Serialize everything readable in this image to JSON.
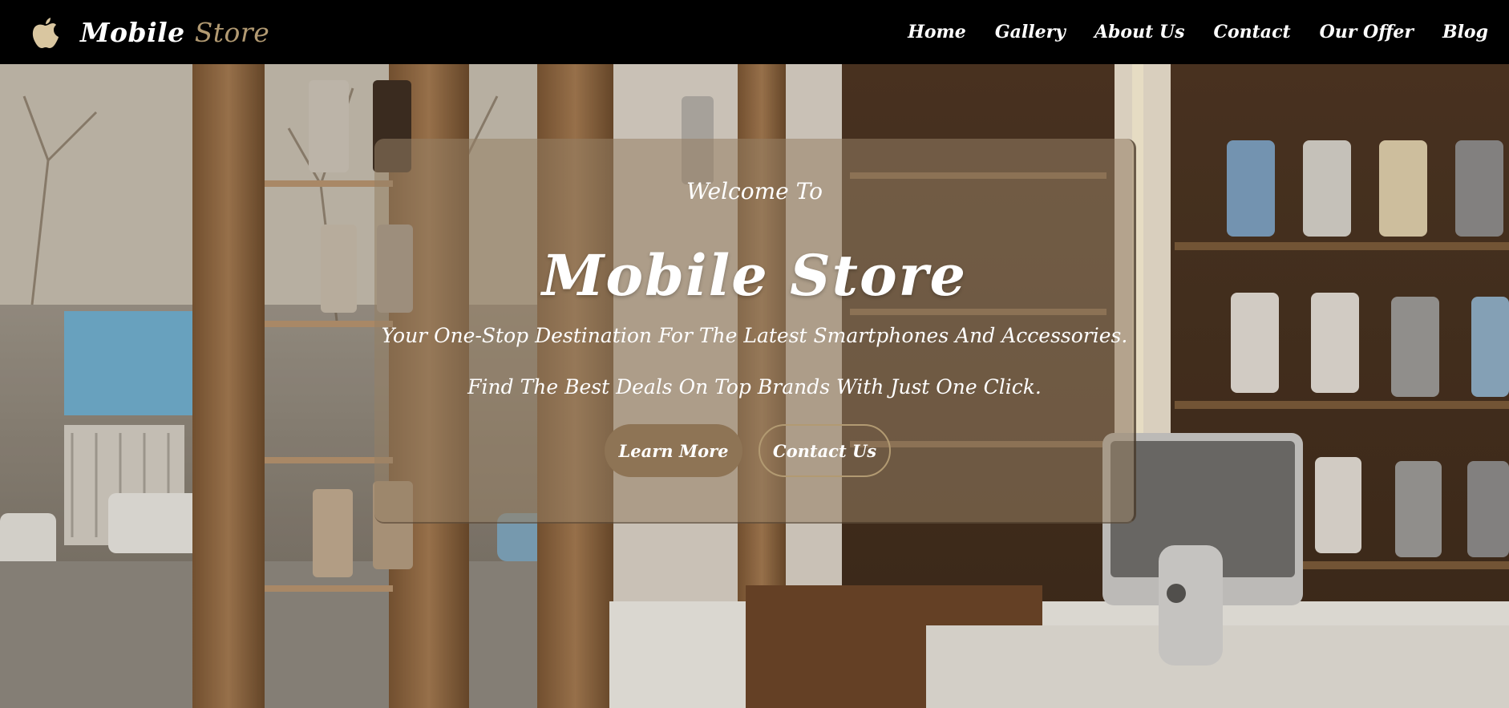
{
  "brand": {
    "name_primary": "Mobile",
    "name_accent": "Store",
    "logo_icon": "apple-icon",
    "logo_color": "#d9c6a0"
  },
  "nav": {
    "items": [
      {
        "label": "Home"
      },
      {
        "label": "Gallery"
      },
      {
        "label": "About Us"
      },
      {
        "label": "Contact"
      },
      {
        "label": "Our Offer"
      },
      {
        "label": "Blog"
      }
    ]
  },
  "hero": {
    "welcome": "Welcome To",
    "title": "Mobile Store",
    "tagline_1": "Your One-Stop Destination For The Latest Smartphones And Accessories.",
    "tagline_2": "Find The Best Deals On Top Brands With Just One Click.",
    "learn_more_label": "Learn More",
    "contact_label": "Contact Us"
  },
  "colors": {
    "navbar_bg": "#000000",
    "accent": "#b29a72",
    "button_fill": "#8e7455",
    "text": "#ffffff"
  }
}
